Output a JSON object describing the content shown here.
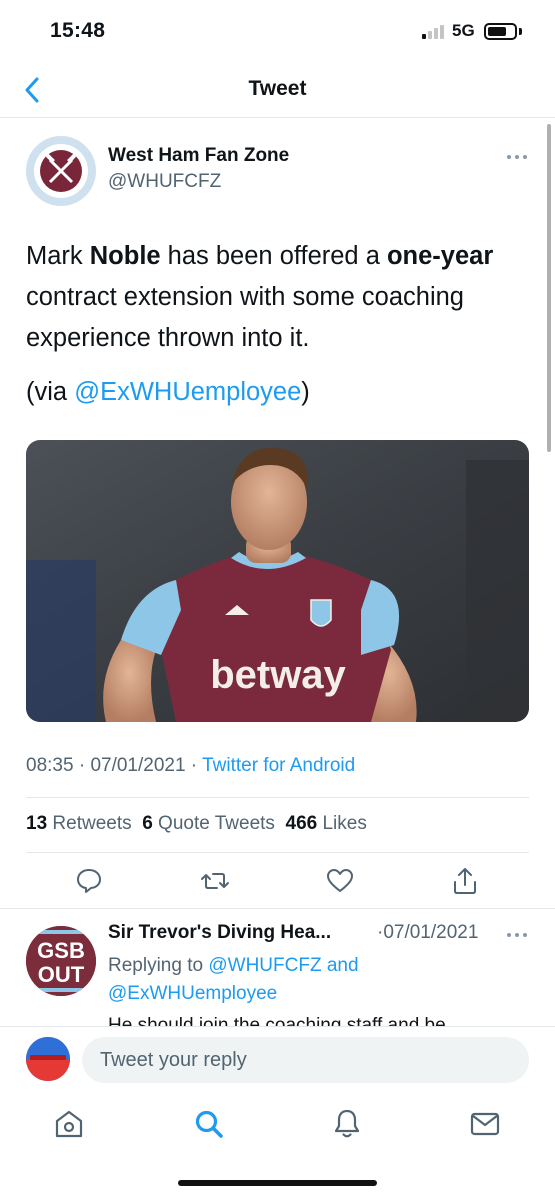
{
  "status": {
    "time": "15:48",
    "network": "5G"
  },
  "header": {
    "title": "Tweet"
  },
  "tweet": {
    "author_name": "West Ham Fan Zone",
    "author_handle": "@WHUFCFZ",
    "text_parts": {
      "p1": "Mark ",
      "p2": "Noble",
      "p3": " has been offered a ",
      "p4": "one-year",
      "p5": " contract extension with some coaching experience thrown into it."
    },
    "via_prefix": "(via ",
    "via_handle": "@ExWHUemployee",
    "via_suffix": ")",
    "media_text": "betway",
    "time": "08:35",
    "date": "07/01/2021",
    "source": "Twitter for Android",
    "retweets_count": "13",
    "retweets_label": "Retweets",
    "quotes_count": "6",
    "quotes_label": "Quote Tweets",
    "likes_count": "466",
    "likes_label": "Likes"
  },
  "reply": {
    "author_name": "Sir Trevor's Diving Hea...",
    "date": "·07/01/2021",
    "replying_prefix": "Replying to ",
    "replying_user1": "@WHUFCFZ",
    "replying_and": " and",
    "replying_user2": "@ExWHUemployee",
    "snippet": "He should join the coaching staff and be",
    "avatar_text_top": "GSB",
    "avatar_text_bottom": "OUT"
  },
  "compose": {
    "placeholder": "Tweet your reply"
  },
  "colors": {
    "accent": "#1d9bf0",
    "text": "#0f1419",
    "muted": "#536471",
    "claret": "#7a263a",
    "sky": "#8ec6e8"
  }
}
